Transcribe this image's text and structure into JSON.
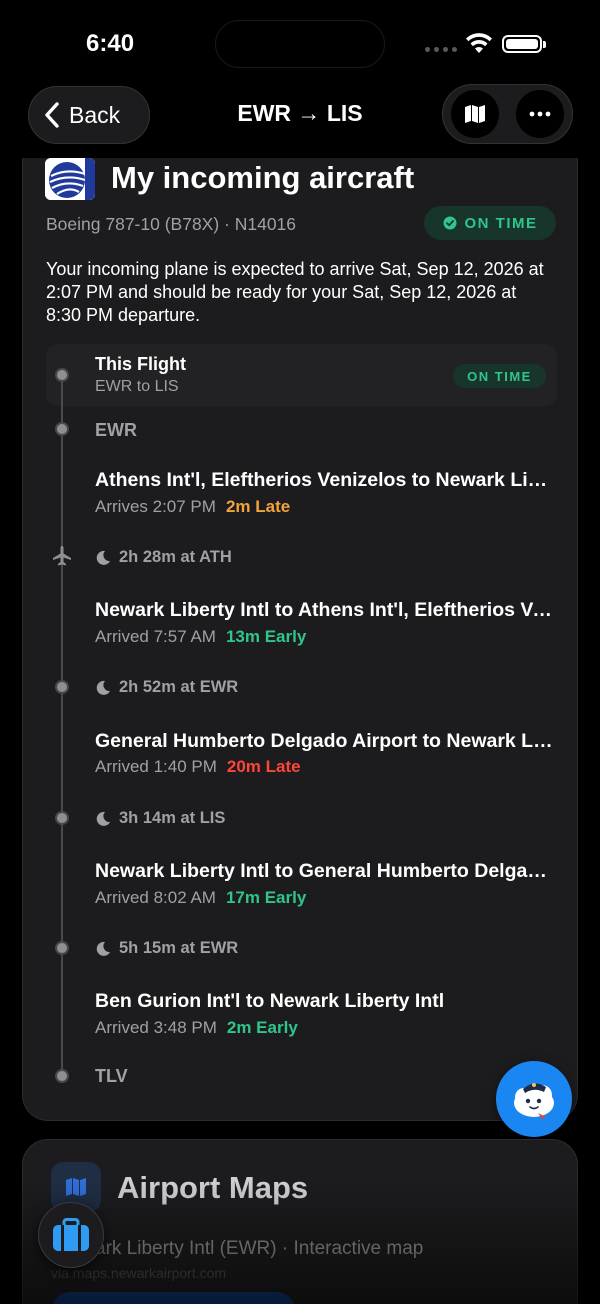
{
  "status_bar": {
    "time": "6:40"
  },
  "nav": {
    "back_label": "Back",
    "title": "EWR → LIS"
  },
  "incoming": {
    "title": "My incoming aircraft",
    "aircraft": "Boeing 787-10 (B78X) · N14016",
    "status": "ON TIME",
    "description": "Your incoming plane is expected to arrive Sat, Sep 12, 2026 at 2:07 PM and should be ready for your Sat, Sep 12, 2026 at 8:30 PM departure.",
    "this_flight": {
      "title": "This Flight",
      "route": "EWR to LIS",
      "status": "ON TIME"
    },
    "timeline": {
      "start_code": "EWR",
      "end_code": "TLV",
      "legs": [
        {
          "title": "Athens Int'l, Eleftherios Venizelos to Newark Liberty Intl",
          "time": "Arrives 2:07 PM",
          "delay": "2m Late"
        },
        {
          "title": "Newark Liberty Intl to Athens Int'l, Eleftherios Venizelos",
          "time": "Arrived 7:57 AM",
          "delay": "13m Early"
        },
        {
          "title": "General Humberto Delgado Airport to Newark Liberty Intl",
          "time": "Arrived 1:40 PM",
          "delay": "20m Late"
        },
        {
          "title": "Newark Liberty Intl to General Humberto Delgado Airport",
          "time": "Arrived 8:02 AM",
          "delay": "17m Early"
        },
        {
          "title": "Ben Gurion Int'l to Newark Liberty Intl",
          "time": "Arrived 3:48 PM",
          "delay": "2m Early"
        }
      ],
      "layovers": [
        "2h 28m at ATH",
        "2h 52m at EWR",
        "3h 14m at LIS",
        "5h 15m at EWR"
      ]
    }
  },
  "airport_maps": {
    "title": "Airport Maps",
    "subtitle": "ark Liberty Intl (EWR) · Interactive map",
    "via": "via maps.newarkairport.com"
  },
  "colors": {
    "on_time_green": "#2fc58b",
    "late_orange": "#f2a33a",
    "late_red": "#ff453a",
    "accent_blue": "#1a86f2"
  }
}
